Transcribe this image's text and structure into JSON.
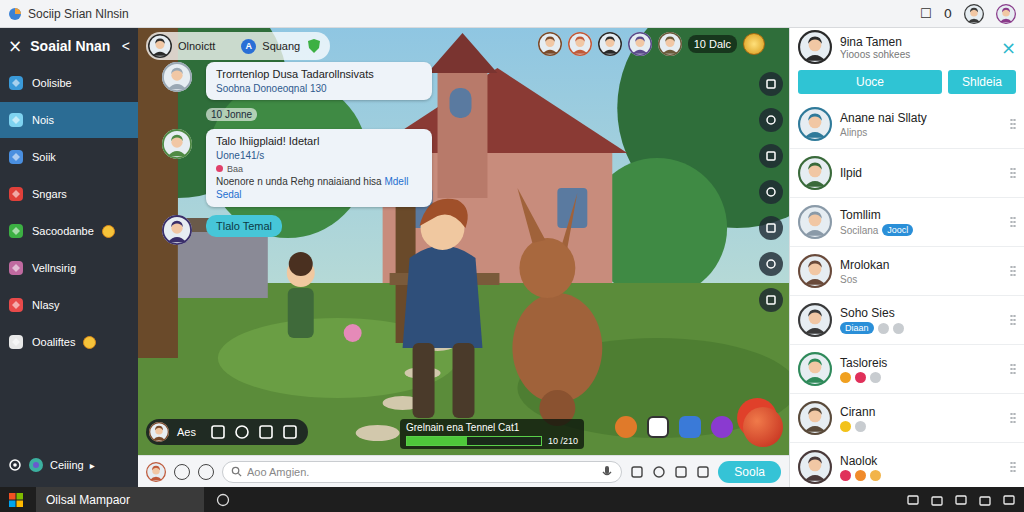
{
  "window": {
    "title": "Sociip Srian Nlnsin",
    "controls": [
      "☐",
      "0"
    ],
    "users": [
      "#3a3a3a",
      "#8a3a8a"
    ]
  },
  "sidebar": {
    "title": "Soaial Nnan",
    "close": "×",
    "collapse": "<",
    "items": [
      {
        "label": "Oolisibe",
        "selected": false,
        "color": "#3a9ad9",
        "emoji": false
      },
      {
        "label": "Nois",
        "selected": true,
        "color": "#7fd3f0",
        "emoji": false
      },
      {
        "label": "Soiik",
        "selected": false,
        "color": "#4a8fe0",
        "emoji": false
      },
      {
        "label": "Sngars",
        "selected": false,
        "color": "#e0403a",
        "emoji": false
      },
      {
        "label": "Sacoodanbe",
        "selected": false,
        "color": "#3cb043",
        "emoji": true
      },
      {
        "label": "Vellnsirig",
        "selected": false,
        "color": "#c06aa0",
        "emoji": false
      },
      {
        "label": "Nlasy",
        "selected": false,
        "color": "#e84a4a",
        "emoji": false
      },
      {
        "label": "Ooaliftes",
        "selected": false,
        "color": "#e8e8e8",
        "emoji": true
      }
    ],
    "footer": {
      "label": "Ceiiing",
      "arrow": "▸"
    }
  },
  "chat": {
    "header": {
      "name": "Olnoictt",
      "channel": "Squang",
      "channel_icon": "A"
    },
    "messages": [
      {
        "kind": "card",
        "title": "Trorrtenlop Dusa Tadarollnsivats",
        "subtitle": "Soobna Donoeoqnal 130",
        "avatar": "#9aa8b4"
      },
      {
        "kind": "time",
        "text": "10 Jonne"
      },
      {
        "kind": "card",
        "title": "Talo Ihiigplaid! Idetarl",
        "subtitle": "Uone141/s",
        "tag": "Baa",
        "body": "Noenore n unda Rehg nnaiaiand hisa",
        "link": "Mdell Sedal",
        "avatar": "#4f8a44"
      },
      {
        "kind": "pill",
        "title": "Tlalo Temal",
        "avatar": "#3a2f6a"
      }
    ]
  },
  "status": {
    "count": "10 Dalc",
    "players": [
      "#7a4a2a",
      "#c05a3a",
      "#2a2a2a",
      "#5a4a8a",
      "#6a5a3a"
    ]
  },
  "toolbar": {
    "label": "Aes"
  },
  "quest": {
    "label": "Grelnain ena Tennel Cat1",
    "level": 0.45,
    "reading": "10 /210"
  },
  "composer": {
    "placeholder": "Aoo Amgien.",
    "send": "Soola"
  },
  "panel": {
    "name": "9ina Tamen",
    "subtitle": "Yiooos sohkees",
    "close": "×",
    "buttons": [
      "Uoce",
      "Shldeia"
    ],
    "contacts": [
      {
        "name": "Anane nai Sllaty",
        "sub": "Alinps",
        "avatar": "#2f7a9a",
        "dots": []
      },
      {
        "name": "Ilpid",
        "avatar": "#3a6a3a",
        "dots": []
      },
      {
        "name": "Tomllim",
        "sub": "Socilana",
        "badge": "Joocl",
        "avatar": "#8a9aa8",
        "dots": []
      },
      {
        "name": "Mrolokan",
        "sub": "Sos",
        "avatar": "#6a4a3a",
        "dots": []
      },
      {
        "name": "Soho Sies",
        "badge": "Diaan",
        "avatar": "#3a3a3a",
        "dots": [
          "#c8ccd0",
          "#c8ccd0"
        ]
      },
      {
        "name": "Tasloreis",
        "avatar": "#2f8a5a",
        "dots": [
          "#f0a020",
          "#e0305a",
          "#c8ccd0"
        ]
      },
      {
        "name": "Cirann",
        "avatar": "#5a4a3a",
        "dots": [
          "#f2c21a",
          "#c8ccd0"
        ]
      },
      {
        "name": "Naolok",
        "avatar": "#4a3a3a",
        "dots": [
          "#e0305a",
          "#f08a2a",
          "#f2b44a"
        ]
      }
    ]
  },
  "taskbar": {
    "app": "Oilsal Mampaor"
  }
}
